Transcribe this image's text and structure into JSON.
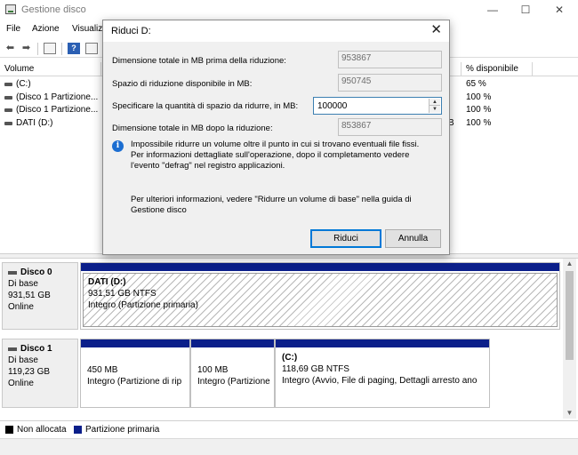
{
  "window": {
    "title": "Gestione disco",
    "controls": [
      "—",
      "☐",
      "✕"
    ]
  },
  "menu": [
    "File",
    "Azione",
    "Visualiz"
  ],
  "toolbar": {
    "icons": [
      "back-arrow-icon",
      "forward-arrow-icon",
      "properties-icon",
      "help-icon",
      "console-icon"
    ],
    "help_glyph": "?"
  },
  "volume_list": {
    "columns": {
      "volume": "Volume",
      "pct_free": "% disponibile"
    },
    "rows": [
      {
        "name": "(C:)",
        "pct": "65 %",
        "extra": ""
      },
      {
        "name": "(Disco 1 Partizione...",
        "pct": "100 %",
        "extra": ""
      },
      {
        "name": "(Disco 1 Partizione...",
        "pct": "100 %",
        "extra": ""
      },
      {
        "name": "DATI (D:)",
        "pct": "100 %",
        "extra": "B"
      }
    ]
  },
  "disks": [
    {
      "name": "Disco 0",
      "type": "Di base",
      "size": "931,51 GB",
      "status": "Online",
      "partitions": [
        {
          "label": "DATI  (D:)",
          "size": "931,51 GB NTFS",
          "status": "Integro (Partizione primaria)"
        }
      ]
    },
    {
      "name": "Disco 1",
      "type": "Di base",
      "size": "119,23 GB",
      "status": "Online",
      "partitions": [
        {
          "label": "",
          "size": "450 MB",
          "status": "Integro (Partizione di rip"
        },
        {
          "label": "",
          "size": "100 MB",
          "status": "Integro (Partizione"
        },
        {
          "label": "(C:)",
          "size": "118,69 GB NTFS",
          "status": "Integro (Avvio, File di paging, Dettagli arresto ano"
        }
      ]
    }
  ],
  "legend": [
    {
      "label": "Non allocata",
      "color": "#000000"
    },
    {
      "label": "Partizione primaria",
      "color": "#0b1f8a"
    }
  ],
  "dialog": {
    "title": "Riduci D:",
    "close": "✕",
    "fields": {
      "total_before_label": "Dimensione totale in MB prima della riduzione:",
      "total_before_value": "953867",
      "available_label": "Spazio di riduzione disponibile in MB:",
      "available_value": "950745",
      "amount_label": "Specificare la quantità di spazio da ridurre, in MB:",
      "amount_value": "100000",
      "total_after_label": "Dimensione totale in MB dopo la riduzione:",
      "total_after_value": "853867"
    },
    "info_text": "Impossibile ridurre un volume oltre il punto in cui si trovano eventuali file fissi. Per informazioni dettagliate sull'operazione, dopo il completamento vedere l'evento \"defrag\" nel registro applicazioni.",
    "more_info": "Per ulteriori informazioni, vedere \"Ridurre un volume di base\" nella guida di Gestione disco",
    "buttons": {
      "ok": "Riduci",
      "cancel": "Annulla"
    }
  }
}
